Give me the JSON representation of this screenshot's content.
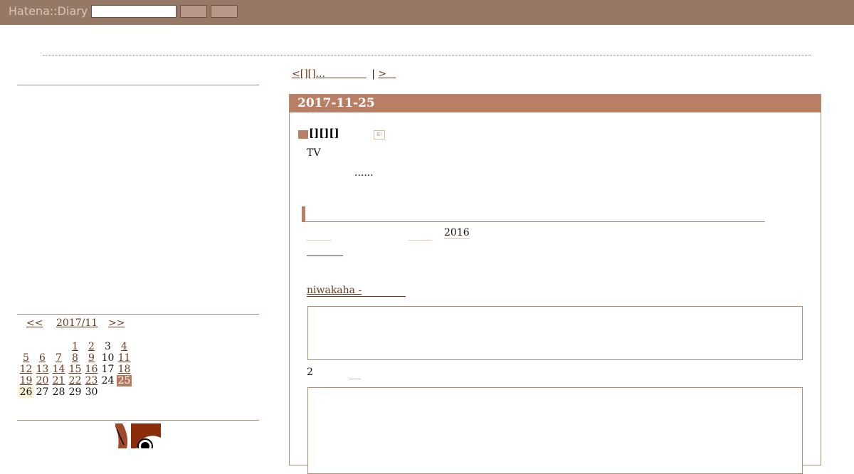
{
  "header": {
    "logo": "Hatena::Diary",
    "search_value": "",
    "buttons": [
      "",
      ""
    ]
  },
  "calendar": {
    "prev_label": "<<",
    "month_label": "2017/11",
    "next_label": ">>",
    "weeks": [
      [
        {
          "d": ""
        },
        {
          "d": ""
        },
        {
          "d": ""
        },
        {
          "d": "1",
          "link": true
        },
        {
          "d": "2",
          "link": true
        },
        {
          "d": "3",
          "link": false
        },
        {
          "d": "4",
          "link": true
        }
      ],
      [
        {
          "d": "5",
          "link": true
        },
        {
          "d": "6",
          "link": true
        },
        {
          "d": "7",
          "link": true
        },
        {
          "d": "8",
          "link": true
        },
        {
          "d": "9",
          "link": true
        },
        {
          "d": "10",
          "link": false
        },
        {
          "d": "11",
          "link": true
        }
      ],
      [
        {
          "d": "12",
          "link": true
        },
        {
          "d": "13",
          "link": true
        },
        {
          "d": "14",
          "link": true
        },
        {
          "d": "15",
          "link": true
        },
        {
          "d": "16",
          "link": true
        },
        {
          "d": "17",
          "link": false
        },
        {
          "d": "18",
          "link": true
        }
      ],
      [
        {
          "d": "19",
          "link": true
        },
        {
          "d": "20",
          "link": true
        },
        {
          "d": "21",
          "link": true
        },
        {
          "d": "22",
          "link": true
        },
        {
          "d": "23",
          "link": true
        },
        {
          "d": "24",
          "link": false
        },
        {
          "d": "25",
          "link": true,
          "today": true
        }
      ],
      [
        {
          "d": "26",
          "link": false,
          "highlight": true
        },
        {
          "d": "27",
          "link": false
        },
        {
          "d": "28",
          "link": false
        },
        {
          "d": "29",
          "link": false
        },
        {
          "d": "30",
          "link": false
        },
        {
          "d": ""
        },
        {
          "d": ""
        }
      ]
    ]
  },
  "main": {
    "pager_prev": "<[][]...",
    "pager_sep": "|",
    "pager_next": ">",
    "date": "2017-11-25",
    "section_title": "[][][]",
    "hatebu_label": "B!",
    "line1": "TV",
    "line2": "......",
    "year": "2016",
    "niwa_link": "niwakaha -",
    "num2": "2"
  },
  "colors": {
    "header_bg": "#957866",
    "accent": "#b87f64",
    "link": "#6b3a1e"
  }
}
